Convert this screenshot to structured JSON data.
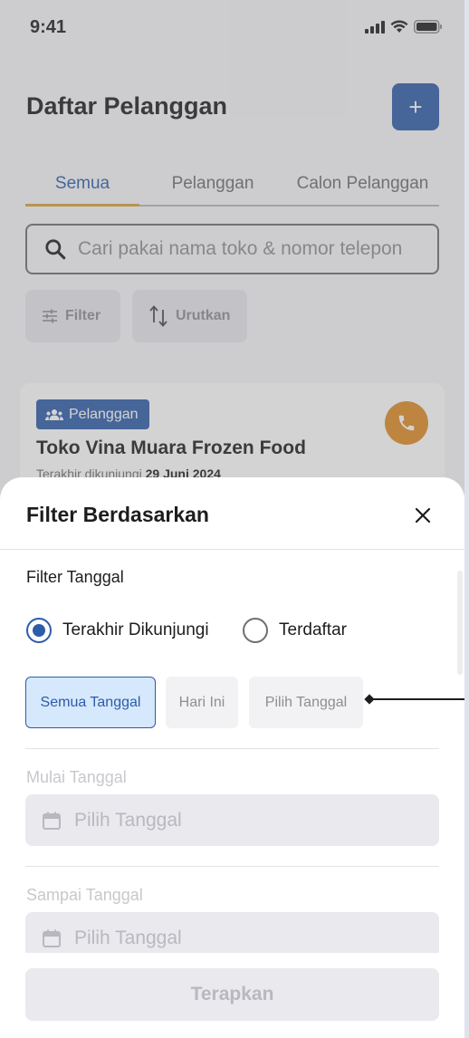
{
  "status_bar": {
    "time": "9:41"
  },
  "header": {
    "title": "Daftar Pelanggan",
    "add_label": "+"
  },
  "tabs": [
    {
      "label": "Semua",
      "active": true
    },
    {
      "label": "Pelanggan",
      "active": false
    },
    {
      "label": "Calon Pelanggan",
      "active": false
    }
  ],
  "search": {
    "placeholder": "Cari pakai nama toko & nomor telepon"
  },
  "toolbar": {
    "filter_label": "Filter",
    "sort_label": "Urutkan"
  },
  "customer_card": {
    "badge": "Pelanggan",
    "name": "Toko Vina Muara Frozen Food",
    "visited_prefix": "Terakhir dikunjungi",
    "visited_date": "29 Juni 2024"
  },
  "filter_sheet": {
    "title": "Filter Berdasarkan",
    "date_section_label": "Filter Tanggal",
    "radio_options": [
      {
        "label": "Terakhir Dikunjungi",
        "selected": true
      },
      {
        "label": "Terdaftar",
        "selected": false
      }
    ],
    "date_pills": [
      {
        "label": "Semua Tanggal",
        "selected": true
      },
      {
        "label": "Hari Ini",
        "selected": false
      },
      {
        "label": "Pilih Tanggal",
        "selected": false
      }
    ],
    "start_label": "Mulai Tanggal",
    "start_placeholder": "Pilih Tanggal",
    "end_label": "Sampai Tanggal",
    "end_placeholder": "Pilih Tanggal",
    "apply_label": "Terapkan"
  },
  "colors": {
    "primary": "#2d5ca8",
    "accent_underline": "#d9a13b",
    "call_button": "#e08b24",
    "selected_pill_bg": "#d6e8fb"
  }
}
